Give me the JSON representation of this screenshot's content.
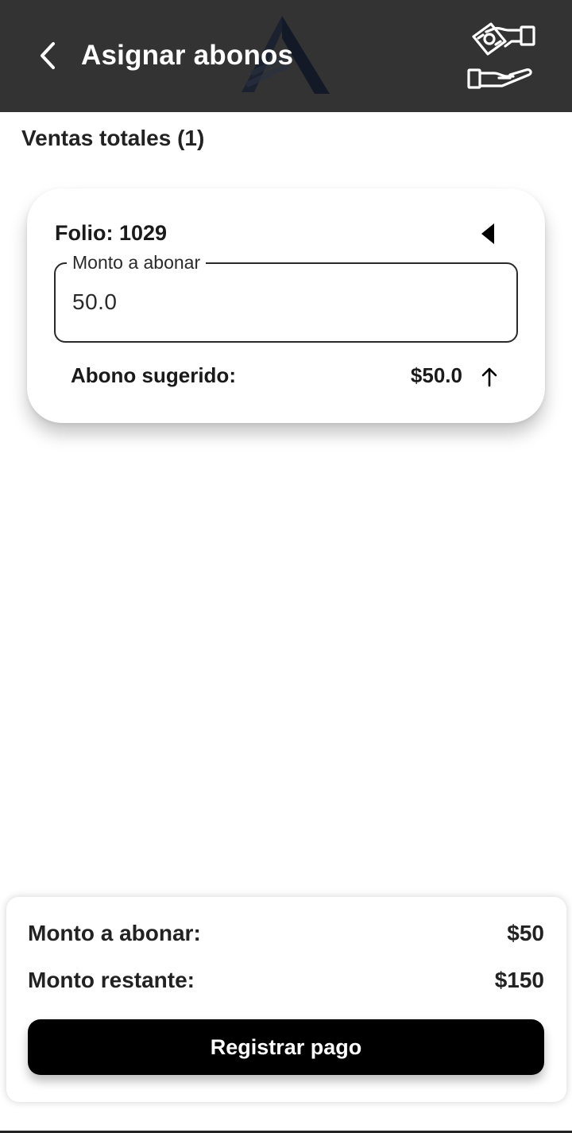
{
  "header": {
    "title": "Asignar abonos",
    "back_icon": "chevron-left-icon",
    "action_icon": "hand-money-icon",
    "background": "#333333"
  },
  "section": {
    "title": "Ventas totales (1)"
  },
  "sale_card": {
    "folio": "Folio: 1029",
    "collapse_icon": "caret-left-icon",
    "amount_field": {
      "label": "Monto a abonar",
      "value": "50.0"
    },
    "suggested": {
      "label": "Abono sugerido:",
      "value": "$50.0",
      "icon": "arrow-up-icon"
    }
  },
  "summary": {
    "amount_label": "Monto a abonar:",
    "amount_value": "$50",
    "remaining_label": "Monto restante:",
    "remaining_value": "$150",
    "register_button": "Registrar pago"
  }
}
